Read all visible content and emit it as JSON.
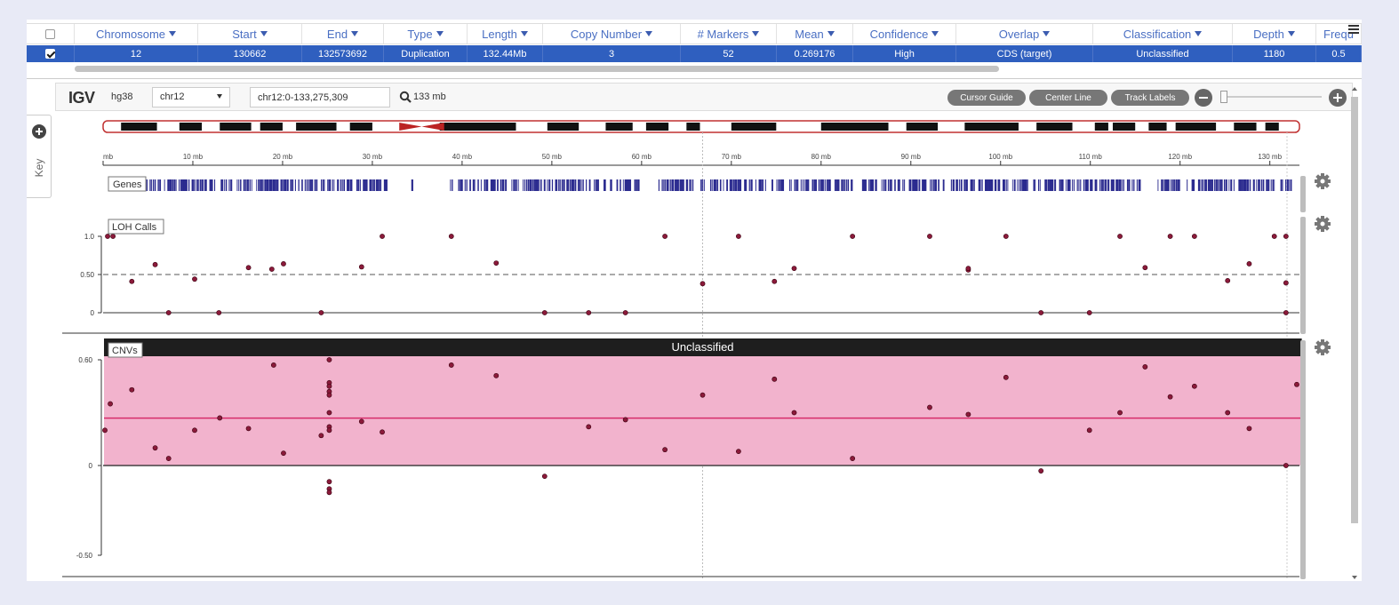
{
  "table": {
    "columns": [
      "Chromosome",
      "Start",
      "End",
      "Type",
      "Length",
      "Copy Number",
      "# Markers",
      "Mean",
      "Confidence",
      "Overlap",
      "Classification",
      "Depth",
      "Frequ"
    ],
    "selected_row": [
      "12",
      "130662",
      "132573692",
      "Duplication",
      "132.44Mb",
      "3",
      "52",
      "0.269176",
      "High",
      "CDS (target)",
      "Unclassified",
      "1180",
      "0.5"
    ]
  },
  "igv": {
    "logo": "IGV",
    "genome": "hg38",
    "chromosome": "chr12",
    "locus": "chr12:0-133,275,309",
    "span": "133 mb",
    "buttons": {
      "cursor_guide": "Cursor Guide",
      "center_line": "Center Line",
      "track_labels": "Track Labels"
    },
    "key_label": "Key",
    "ruler_ticks": [
      "mb",
      "10 mb",
      "20 mb",
      "30 mb",
      "40 mb",
      "50 mb",
      "60 mb",
      "70 mb",
      "80 mb",
      "90 mb",
      "100 mb",
      "110 mb",
      "120 mb",
      "130 mb"
    ],
    "tracks": {
      "genes": "Genes",
      "loh": "LOH Calls",
      "cnvs": "CNVs",
      "cnv_segment_label": "Unclassified"
    },
    "loh_axis": [
      "1.0",
      "0.50",
      "0"
    ],
    "cnv_axis": [
      "0.60",
      "0",
      "-0.50"
    ],
    "colors": {
      "accent": "#2f5fbf",
      "cnv_band": "#f2b3cd",
      "point": "#8b1a3a",
      "genes": "#2b2b8f"
    }
  },
  "chart_data": [
    {
      "type": "scatter",
      "title": "LOH Calls",
      "xlabel": "",
      "ylabel": "",
      "xlim": [
        0,
        133.3
      ],
      "ylim": [
        0,
        1.0
      ],
      "reference_line": 0.5,
      "points": [
        [
          0.5,
          1.0
        ],
        [
          1.1,
          1.0
        ],
        [
          3.2,
          0.41
        ],
        [
          5.8,
          0.63
        ],
        [
          7.3,
          0
        ],
        [
          10.2,
          0.44
        ],
        [
          12.9,
          0
        ],
        [
          16.2,
          0.59
        ],
        [
          18.8,
          0.57
        ],
        [
          20.1,
          0.64
        ],
        [
          24.3,
          0
        ],
        [
          28.8,
          0.6
        ],
        [
          31.1,
          1.0
        ],
        [
          38.8,
          1.0
        ],
        [
          43.8,
          0.65
        ],
        [
          49.2,
          0
        ],
        [
          54.1,
          0
        ],
        [
          58.2,
          0
        ],
        [
          62.6,
          1.0
        ],
        [
          66.8,
          0.38
        ],
        [
          70.8,
          1.0
        ],
        [
          74.8,
          0.41
        ],
        [
          77.0,
          0.58
        ],
        [
          83.5,
          1.0
        ],
        [
          92.1,
          1.0
        ],
        [
          96.4,
          0.56
        ],
        [
          96.4,
          0.58
        ],
        [
          100.6,
          1.0
        ],
        [
          104.5,
          0
        ],
        [
          109.9,
          0
        ],
        [
          113.3,
          1.0
        ],
        [
          116.1,
          0.59
        ],
        [
          118.9,
          1.0
        ],
        [
          121.6,
          1.0
        ],
        [
          125.3,
          0.42
        ],
        [
          127.7,
          0.64
        ],
        [
          130.5,
          1.0
        ],
        [
          131.8,
          1.0
        ],
        [
          131.8,
          0.39
        ],
        [
          131.8,
          0
        ]
      ]
    },
    {
      "type": "scatter",
      "title": "CNVs",
      "xlabel": "",
      "ylabel": "",
      "xlim": [
        0,
        133.3
      ],
      "ylim": [
        -0.5,
        0.6
      ],
      "segment": {
        "label": "Unclassified",
        "start": 0.1,
        "end": 132.57,
        "mean": 0.269176
      },
      "points": [
        [
          0.2,
          0.2
        ],
        [
          0.8,
          0.35
        ],
        [
          3.2,
          0.43
        ],
        [
          5.8,
          0.1
        ],
        [
          7.3,
          0.04
        ],
        [
          10.2,
          0.2
        ],
        [
          13.0,
          0.27
        ],
        [
          16.2,
          0.21
        ],
        [
          20.1,
          0.07
        ],
        [
          19.0,
          0.57
        ],
        [
          24.3,
          0.17
        ],
        [
          25.2,
          0.6
        ],
        [
          25.2,
          0.47
        ],
        [
          25.2,
          0.45
        ],
        [
          25.2,
          0.42
        ],
        [
          25.2,
          0.4
        ],
        [
          25.2,
          0.3
        ],
        [
          25.2,
          0.22
        ],
        [
          25.2,
          0.2
        ],
        [
          25.2,
          -0.09
        ],
        [
          25.2,
          -0.13
        ],
        [
          25.2,
          -0.15
        ],
        [
          28.8,
          0.25
        ],
        [
          31.1,
          0.19
        ],
        [
          38.8,
          0.57
        ],
        [
          43.8,
          0.51
        ],
        [
          49.2,
          -0.06
        ],
        [
          54.1,
          0.22
        ],
        [
          58.2,
          0.26
        ],
        [
          62.6,
          0.09
        ],
        [
          66.8,
          0.4
        ],
        [
          70.8,
          0.08
        ],
        [
          74.8,
          0.49
        ],
        [
          77.0,
          0.3
        ],
        [
          83.5,
          0.04
        ],
        [
          92.1,
          0.33
        ],
        [
          96.4,
          0.29
        ],
        [
          100.6,
          0.5
        ],
        [
          104.5,
          -0.03
        ],
        [
          109.9,
          0.2
        ],
        [
          113.3,
          0.3
        ],
        [
          116.1,
          0.56
        ],
        [
          118.9,
          0.39
        ],
        [
          121.6,
          0.45
        ],
        [
          125.3,
          0.3
        ],
        [
          127.7,
          0.21
        ],
        [
          131.8,
          0
        ],
        [
          133.0,
          0.46
        ]
      ]
    }
  ]
}
